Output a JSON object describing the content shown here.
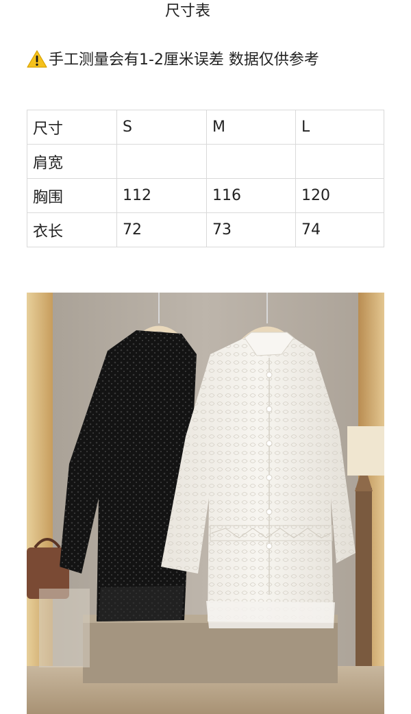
{
  "page": {
    "title": "尺寸表",
    "note": "手工测量会有1-2厘米误差  数据仅供参考"
  },
  "icons": {
    "warning": "warning-icon"
  },
  "size_table": {
    "header": [
      "尺寸",
      "S",
      "M",
      "L"
    ],
    "rows": [
      [
        "肩宽",
        "",
        "",
        ""
      ],
      [
        "胸围",
        "112",
        "116",
        "120"
      ],
      [
        "衣长",
        "72",
        "73",
        "74"
      ]
    ]
  },
  "photo": {
    "subject": "black-sequin-shirt and white-embroidered-shirt on hangers",
    "colors": {
      "wall": "#b9b2a8",
      "wood": "#d9b77e",
      "black_shirt": "#141414",
      "white_shirt": "#f1eee8"
    }
  }
}
